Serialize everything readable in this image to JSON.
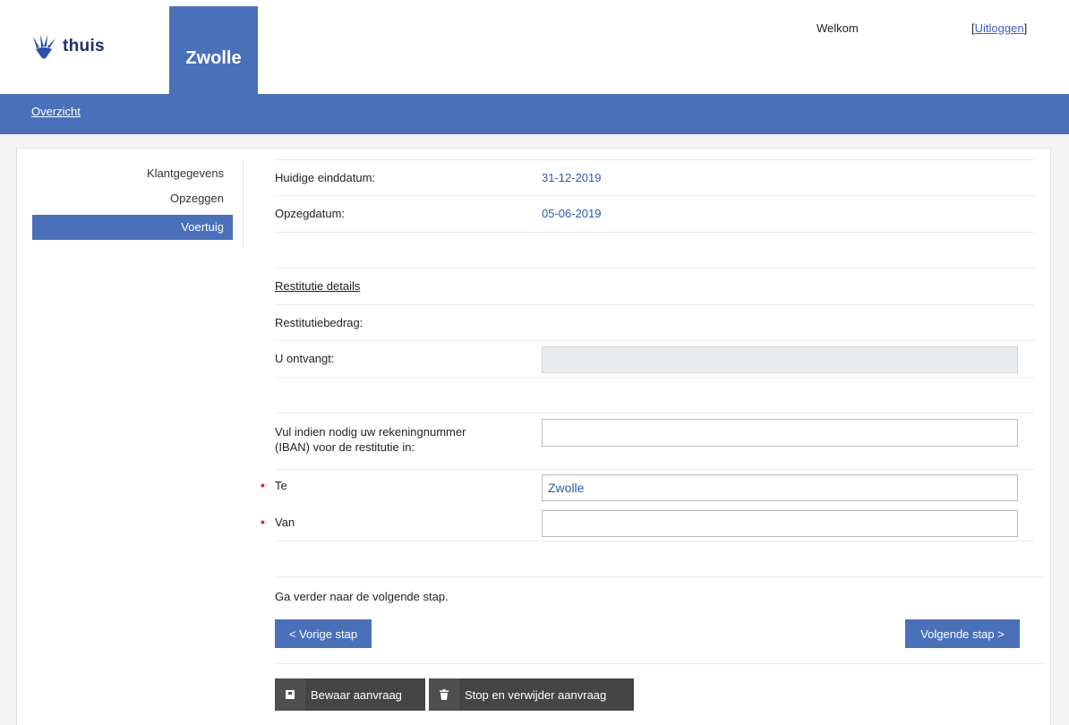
{
  "header": {
    "logo_text": "thuis",
    "city": "Zwolle",
    "welcome": "Welkom",
    "logout_open": "[",
    "logout_label": "Uitloggen",
    "logout_close": "]"
  },
  "nav": {
    "overview_label": "Overzicht"
  },
  "sidebar": {
    "items": [
      {
        "label": "Klantgegevens"
      },
      {
        "label": "Opzeggen"
      },
      {
        "label": "Voertuig"
      }
    ]
  },
  "form": {
    "end_date_label": "Huidige einddatum:",
    "end_date_value": "31-12-2019",
    "cancel_date_label": "Opzegdatum:",
    "cancel_date_value": "05-06-2019",
    "refund_section": "Restitutie details",
    "refund_amount_label": "Restitutiebedrag:",
    "receive_label": "U ontvangt:",
    "receive_value": "",
    "iban_label_line1": "Vul indien nodig uw rekeningnummer",
    "iban_label_line2": "(IBAN) voor de restitutie in:",
    "iban_value": "",
    "te_label": "Te",
    "te_value": "Zwolle",
    "van_label": "Van",
    "van_value": "",
    "required_mark": "•",
    "continue_text": "Ga verder naar de volgende stap."
  },
  "buttons": {
    "prev": "< Vorige stap",
    "next": "Volgende stap >",
    "save": "Bewaar aanvraag",
    "stop": "Stop en verwijder aanvraag"
  },
  "colors": {
    "brand": "#4a70ba",
    "link": "#2f59a8",
    "dark_button": "#454545",
    "required": "#dd2222"
  }
}
